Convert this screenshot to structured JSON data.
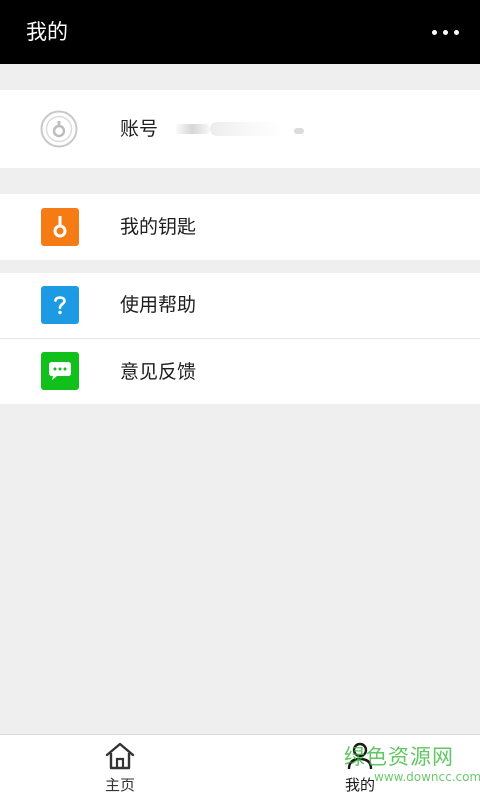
{
  "header": {
    "title": "我的",
    "more_icon": "more-dots-icon"
  },
  "account": {
    "label": "账号",
    "avatar_icon": "user-placeholder-icon",
    "value_redacted": true
  },
  "menu": {
    "keys": {
      "label": "我的钥匙",
      "icon": "key-icon",
      "color": "#f57c14"
    },
    "help": {
      "label": "使用帮助",
      "icon": "question-mark-icon",
      "color": "#1c9be4"
    },
    "feedback": {
      "label": "意见反馈",
      "icon": "chat-bubble-icon",
      "color": "#11c01a"
    }
  },
  "bottom_nav": {
    "items": [
      {
        "label": "主页",
        "icon": "home-icon",
        "active": false
      },
      {
        "label": "我的",
        "icon": "user-icon",
        "active": true
      }
    ]
  },
  "watermark": {
    "main": "绿色资源网",
    "sub": "www.downcc.com"
  }
}
